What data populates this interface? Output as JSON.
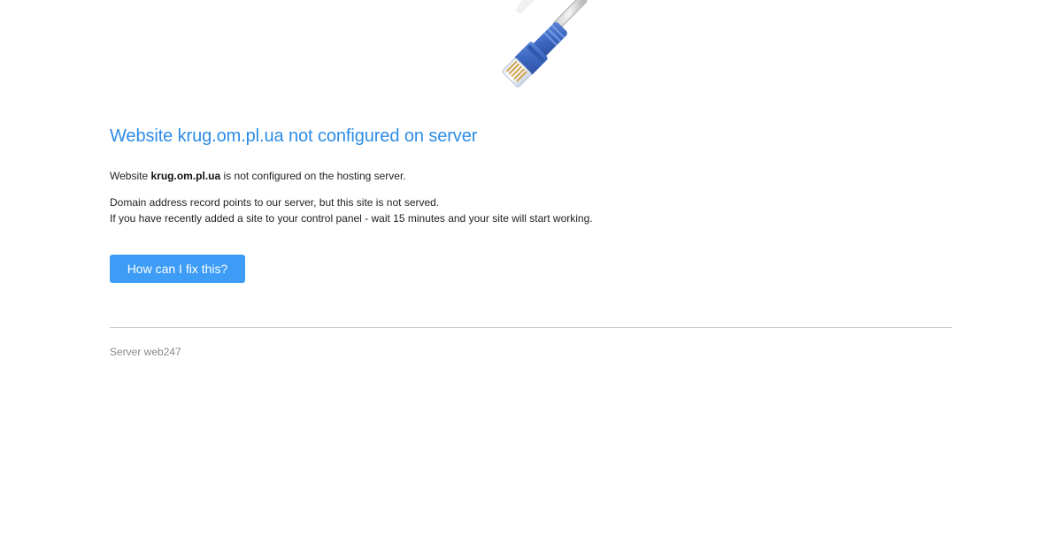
{
  "illustration": {
    "icon": "network-cable-icon"
  },
  "title": {
    "prefix": "Website",
    "domain": "krug.om.pl.ua",
    "suffix": "not configured on server"
  },
  "message": {
    "line1_prefix": "Website",
    "line1_domain": "krug.om.pl.ua",
    "line1_suffix": "is not configured on the hosting server.",
    "line2": "Domain address record points to our server, but this site is not served.",
    "line3": "If you have recently added a site to your control panel - wait 15 minutes and your site will start working."
  },
  "fix_button": {
    "label": "How can I fix this?"
  },
  "footer": {
    "server_label": "Server web247"
  },
  "colors": {
    "title": "#2d8ce6",
    "button": "#3d9cf5",
    "divider": "#c8c8c8",
    "footer_text": "#8a8a8a",
    "cable_plug": "#3d68c2"
  }
}
